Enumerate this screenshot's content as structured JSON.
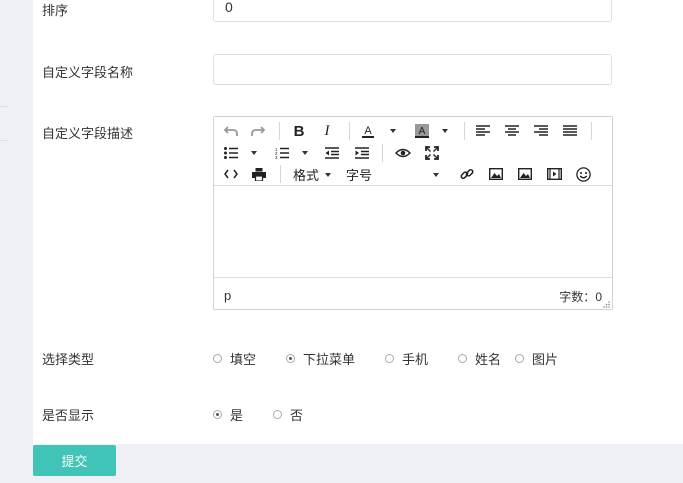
{
  "form": {
    "sort": {
      "label": "排序",
      "value": "0"
    },
    "field_name": {
      "label": "自定义字段名称",
      "value": "",
      "placeholder": ""
    },
    "field_desc": {
      "label": "自定义字段描述",
      "editor": {
        "format_label": "格式",
        "fontsize_label": "字号",
        "status_path": "p",
        "word_count_label": "字数：",
        "word_count": "0"
      }
    },
    "type": {
      "label": "选择类型",
      "options": [
        {
          "label": "填空",
          "checked": false
        },
        {
          "label": "下拉菜单",
          "checked": true
        },
        {
          "label": "手机",
          "checked": false
        },
        {
          "label": "姓名",
          "checked": false
        },
        {
          "label": "图片",
          "checked": false
        }
      ]
    },
    "display": {
      "label": "是否显示",
      "options": [
        {
          "label": "是",
          "checked": true
        },
        {
          "label": "否",
          "checked": false
        }
      ]
    },
    "submit_label": "提交"
  },
  "colors": {
    "accent": "#40c4b8",
    "background": "#eef0f5"
  },
  "icons": [
    "undo-icon",
    "redo-icon",
    "bold-icon",
    "italic-icon",
    "font-color-icon",
    "background-color-icon",
    "align-left-icon",
    "align-center-icon",
    "align-right-icon",
    "align-justify-icon",
    "bullet-list-icon",
    "numbered-list-icon",
    "outdent-icon",
    "indent-icon",
    "preview-icon",
    "fullscreen-icon",
    "source-code-icon",
    "print-icon",
    "link-icon",
    "image-icon",
    "image-icon",
    "media-icon",
    "emoji-icon"
  ]
}
